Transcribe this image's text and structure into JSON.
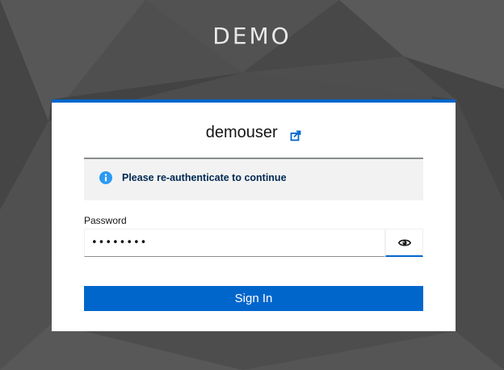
{
  "realm": {
    "title": "DEMO"
  },
  "login": {
    "username": "demouser",
    "restart_icon": "restart-login-icon",
    "alert": {
      "icon": "info-circle-icon",
      "message": "Please re-authenticate to continue"
    },
    "password": {
      "label": "Password",
      "value": "••••••••",
      "toggle_icon": "eye-icon"
    },
    "submit_label": "Sign In"
  },
  "colors": {
    "accent": "#0066cc",
    "background": "#4a4a4a",
    "alert_bg": "#f2f2f2",
    "alert_text": "#002952",
    "info_icon": "#2b9af3"
  }
}
